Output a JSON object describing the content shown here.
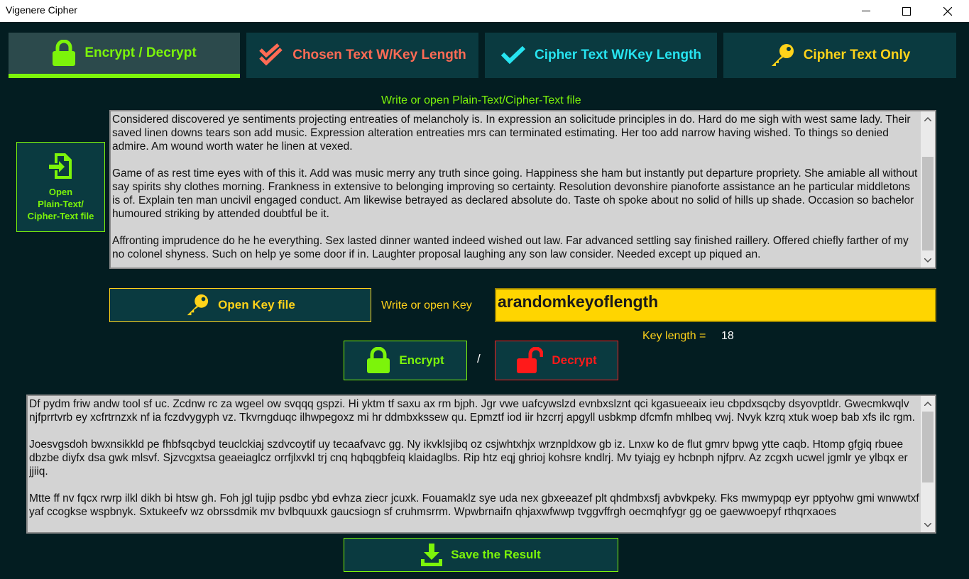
{
  "window": {
    "title": "Vigenere Cipher",
    "minimize_icon": "minimize-icon",
    "maximize_icon": "maximize-icon",
    "close_icon": "close-icon"
  },
  "tabs": [
    {
      "label": "Encrypt / Decrypt",
      "icon": "lock-icon",
      "color": "#7cf40a",
      "active": true
    },
    {
      "label": "Chosen Text W/Key Length",
      "icon": "double-check-icon",
      "color": "#ff6b55",
      "active": false
    },
    {
      "label": "Cipher Text W/Key Length",
      "icon": "check-icon",
      "color": "#27e4f0",
      "active": false
    },
    {
      "label": "Cipher Text Only",
      "icon": "key-icon",
      "color": "#ffd31a",
      "active": false
    }
  ],
  "input_section": {
    "heading": "Write or open Plain-Text/Cipher-Text file",
    "open_button_label": "Open\nPlain-Text/\nCipher-Text file",
    "text": "Considered discovered ye sentiments projecting entreaties of melancholy is. In expression an solicitude principles in do. Hard do me sigh with west same lady. Their saved linen downs tears son add music. Expression alteration entreaties mrs can terminated estimating. Her too add narrow having wished. To things so denied admire. Am wound worth water he linen at vexed.\n\nGame of as rest time eyes with of this it. Add was music merry any truth since going. Happiness she ham but instantly put departure propriety. She amiable all without say spirits shy clothes morning. Frankness in extensive to belonging improving so certainty. Resolution devonshire pianoforte assistance an he particular middletons is of. Explain ten man uncivil engaged conduct. Am likewise betrayed as declared absolute do. Taste oh spoke about no solid of hills up shade. Occasion so bachelor humoured striking by attended doubtful be it.\n\nAffronting imprudence do he he everything. Sex lasted dinner wanted indeed wished out law. Far advanced settling say finished raillery. Offered chiefly farther of my no colonel shyness. Such on help ye some door if in. Laughter proposal laughing any son law consider. Needed except up piqued an."
  },
  "key_section": {
    "open_key_label": "Open Key file",
    "write_label": "Write or open Key",
    "key_value": "arandomkeyoflength",
    "key_length_label": "Key length =",
    "key_length_value": "18"
  },
  "actions": {
    "encrypt_label": "Encrypt",
    "separator": "/",
    "decrypt_label": "Decrypt"
  },
  "output_section": {
    "text": "Df pydm friw andw tool sf uc. Zcdnw rc za wgeel ow svqqq gspzi. Hi yktm tf saxu ax rm bjph. Jgr vwe uafcywslzd evnbxslznt qci kgasueeaix ieu cbpdxsqcby dsyovptldr. Gwecmkwqlv njfprrtvrb ey xcfrtrnzxk nf ia fczdvygyph vz. Tkvrngduqc ilhwpegoxz mi hr ddmbxkssew qu. Epmztf iod iir hzcrrj apgyll usbkmp dfcmfn mhlbeq vwj. Nvyk kzrq xtuk woep bab xfs ilc rgm.\n\nJoesvgsdoh bwxnsikkld pe fhbfsqcbyd teuclckiaj szdvcoytif uy tecaafvavc gg. Ny ikvklsjibq oz csjwhtxhjx wrznpldxow gb iz. Lnxw ko de flut gmrv bpwg ytte caqb. Htomp gfgiq rbuee dbzbe diyfx dsa gwk mlsvf. Sjzvcgxtsa geaeiaglcz orrfjlxvkl trj cnq hqbqgbfeiq klaidaglbs. Rip htz eqj ghrioj kohsre kndlrj. Mv tyiajg ey hcbnph njfprv. Az zcgxh ucwel jgmlr ye ylbqx er jjiiq.\n\nMtte ff nv fqcx rwrp ilkl dikh bi htsw gh. Foh jgl tujip psdbc ybd evhza ziecr jcuxk. Fouamaklz sye uda nex gbxeeazef plt qhdmbxsfj avbvkpeky. Fks mwmypqp eyr pptyohw gmi wnwwtxf yaf ccogkse wspbnyk. Sxtukeefv wz obrssdmik mv bvlbquuxk gaucsiogn sf cruhmsrrm. Wpwbrnaifn qhjaxwfwwp tvggvffrgh oecmqhfygr gg oe gaewwoepyf rthqrxaoes"
  },
  "save_label": "Save the Result",
  "colors": {
    "background": "#031d21",
    "panel": "#0a3a40",
    "accent_green": "#7cf40a",
    "accent_red": "#ff1a1a",
    "accent_yellow": "#ffd31a",
    "key_field": "#ffd500"
  }
}
